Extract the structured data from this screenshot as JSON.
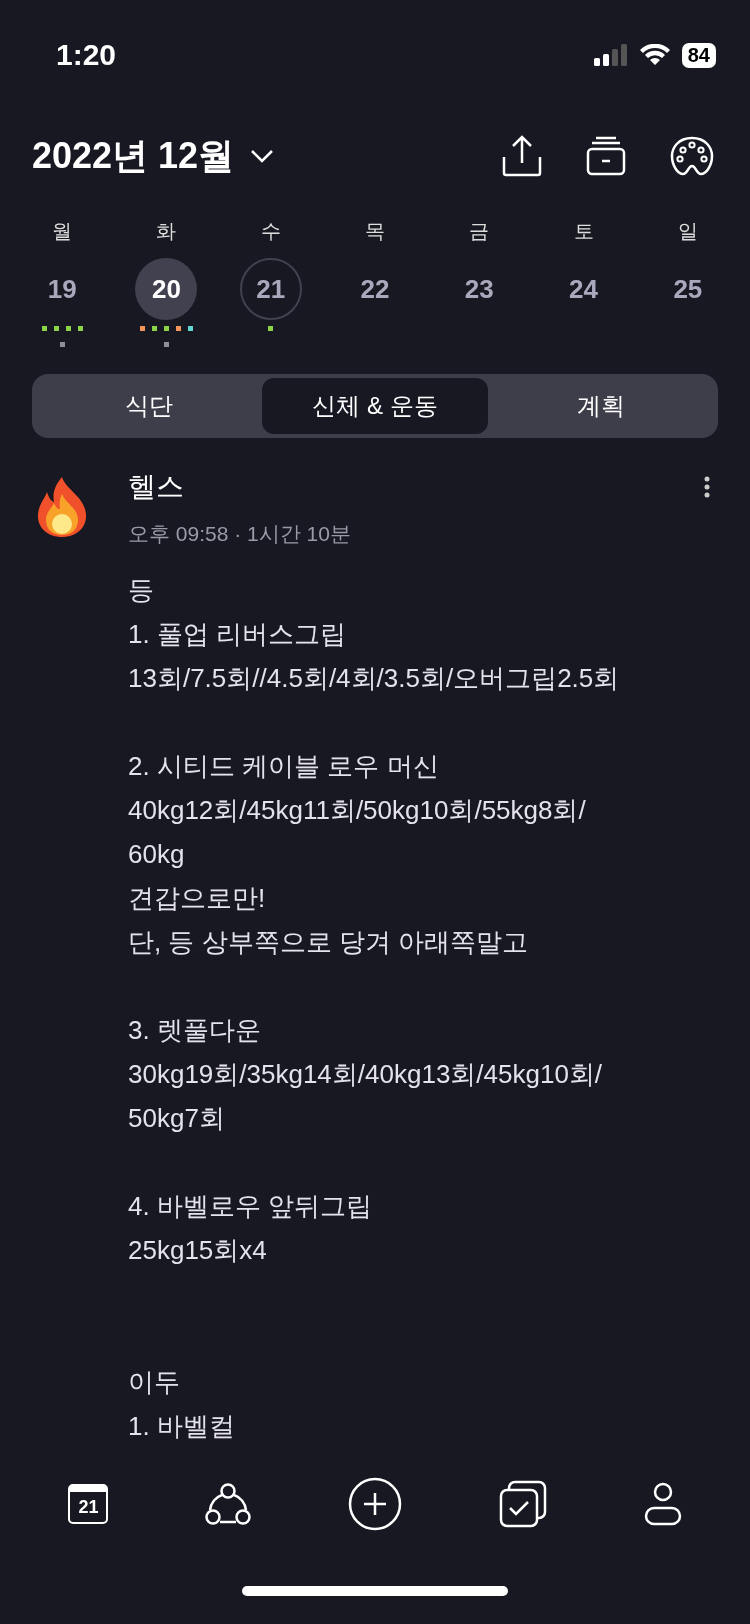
{
  "status_bar": {
    "time": "1:20",
    "battery": "84"
  },
  "header": {
    "title": "2022년 12월"
  },
  "week": [
    {
      "weekday": "월",
      "date": "19",
      "selected": false,
      "today": false,
      "dots": [
        {
          "color": "#8bd448"
        },
        {
          "color": "#8bd448"
        },
        {
          "color": "#8bd448"
        },
        {
          "color": "#8bd448"
        }
      ],
      "marks": [
        {
          "color": "#8e8e98"
        }
      ]
    },
    {
      "weekday": "화",
      "date": "20",
      "selected": true,
      "today": false,
      "dots": [
        {
          "color": "#f2955a"
        },
        {
          "color": "#8bd448"
        },
        {
          "color": "#8bd448"
        },
        {
          "color": "#f2955a"
        },
        {
          "color": "#5fd6cf"
        }
      ],
      "marks": [
        {
          "color": "#8e8e98"
        }
      ]
    },
    {
      "weekday": "수",
      "date": "21",
      "selected": false,
      "today": true,
      "dots": [
        {
          "color": "#8bd448"
        }
      ]
    },
    {
      "weekday": "목",
      "date": "22",
      "selected": false,
      "today": false
    },
    {
      "weekday": "금",
      "date": "23",
      "selected": false,
      "today": false
    },
    {
      "weekday": "토",
      "date": "24",
      "selected": false,
      "today": false
    },
    {
      "weekday": "일",
      "date": "25",
      "selected": false,
      "today": false
    }
  ],
  "tabs": [
    {
      "label": "식단",
      "selected": false
    },
    {
      "label": "신체 & 운동",
      "selected": true
    },
    {
      "label": "계획",
      "selected": false
    }
  ],
  "entry": {
    "title": "헬스",
    "meta": "오후 09:58 · 1시간 10분",
    "blocks": [
      {
        "kind": "start",
        "lines": [
          "등",
          "1. 풀업 리버스그립",
          "13회/7.5회//4.5회/4회/3.5회/오버그립2.5회"
        ]
      },
      {
        "kind": "paragraph",
        "lines": [
          "2. 시티드 케이블 로우 머신",
          "40kg12회/45kg11회/50kg10회/55kg8회/",
          "60kg",
          "견갑으로만!",
          "단, 등 상부쪽으로 당겨 아래쪽말고"
        ]
      },
      {
        "kind": "paragraph",
        "lines": [
          "3. 렛풀다운",
          "30kg19회/35kg14회/40kg13회/45kg10회/",
          "50kg7회"
        ]
      },
      {
        "kind": "paragraph",
        "lines": [
          "4. 바벨로우 앞뒤그립",
          "25kg15회x4"
        ]
      },
      {
        "kind": "section",
        "lines": [
          "이두",
          "1. 바벨컬"
        ]
      }
    ]
  },
  "nav": {
    "calendar_day": "21"
  }
}
